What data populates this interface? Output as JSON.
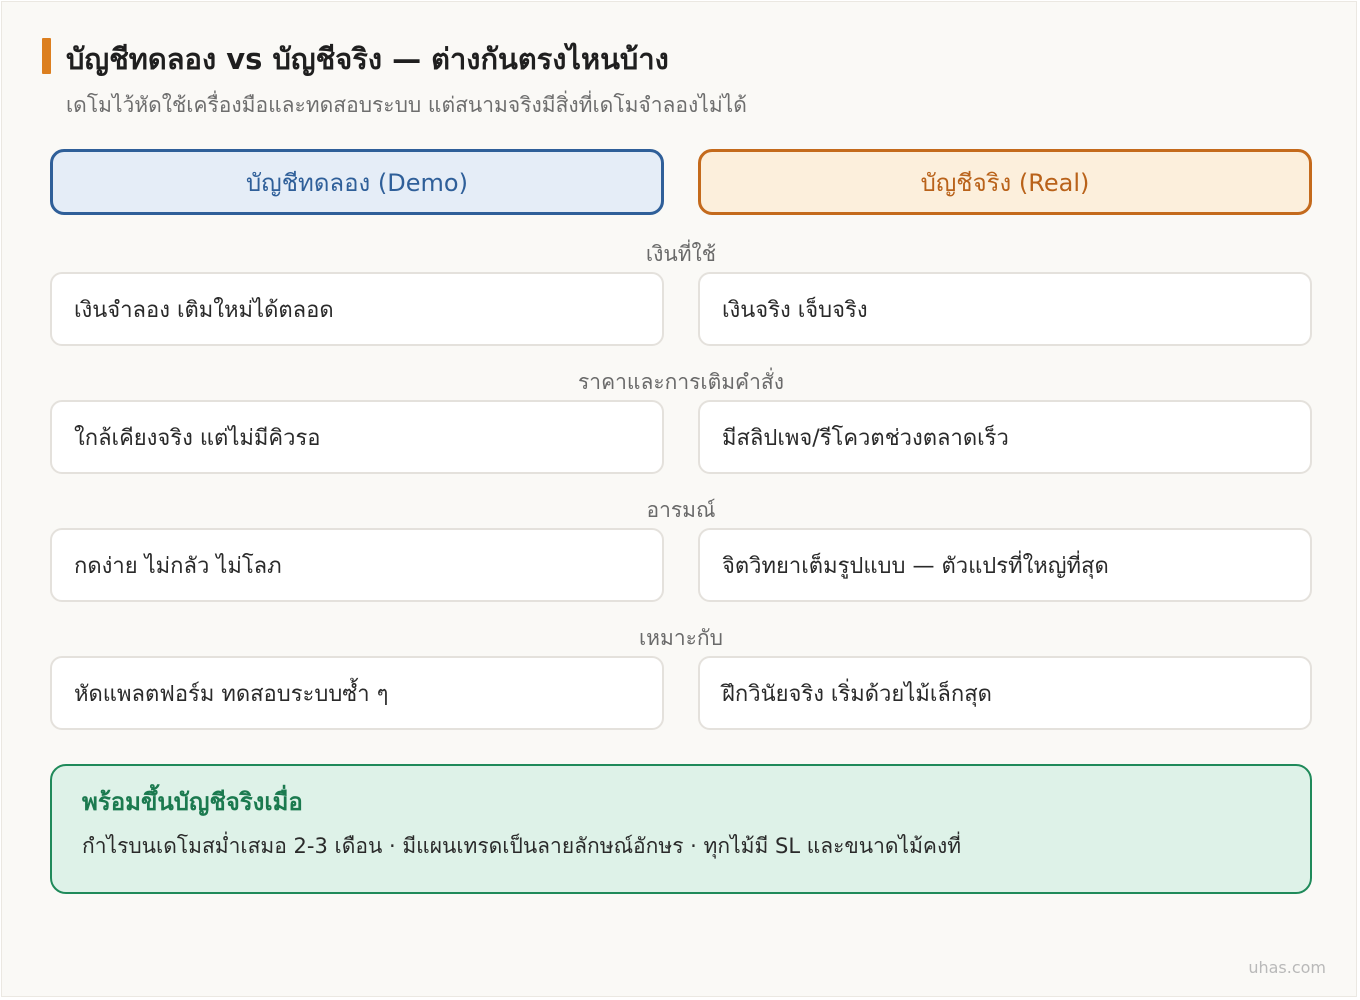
{
  "header": {
    "title": "บัญชีทดลอง vs บัญชีจริง — ต่างกันตรงไหนบ้าง",
    "subtitle": "เดโมไว้หัดใช้เครื่องมือและทดสอบระบบ แต่สนามจริงมีสิ่งที่เดโมจำลองไม่ได้"
  },
  "columns": {
    "demo": "บัญชีทดลอง (Demo)",
    "real": "บัญชีจริง (Real)"
  },
  "rows": [
    {
      "label": "เงินที่ใช้",
      "demo": "เงินจำลอง เติมใหม่ได้ตลอด",
      "real": "เงินจริง เจ็บจริง"
    },
    {
      "label": "ราคาและการเติมคำสั่ง",
      "demo": "ใกล้เคียงจริง แต่ไม่มีคิวรอ",
      "real": "มีสลิปเพจ/รีโควตช่วงตลาดเร็ว"
    },
    {
      "label": "อารมณ์",
      "demo": "กดง่าย ไม่กลัว ไม่โลภ",
      "real": "จิตวิทยาเต็มรูปแบบ — ตัวแปรที่ใหญ่ที่สุด"
    },
    {
      "label": "เหมาะกับ",
      "demo": "หัดแพลตฟอร์ม ทดสอบระบบซ้ำ ๆ",
      "real": "ฝึกวินัยจริง เริ่มด้วยไม้เล็กสุด"
    }
  ],
  "ready": {
    "title": "พร้อมขึ้นบัญชีจริงเมื่อ",
    "body": "กำไรบนเดโมสม่ำเสมอ 2-3 เดือน · มีแผนเทรดเป็นลายลักษณ์อักษร · ทุกไม้มี SL และขนาดไม้คงที่"
  },
  "watermark": "uhas.com",
  "colors": {
    "accent": "#dc7f1f",
    "demo_border": "#2f5f99",
    "demo_fill": "#e5edf7",
    "real_border": "#c46a1c",
    "real_fill": "#fcefdc",
    "ready_border": "#1f8a5a",
    "ready_fill": "#def2e8"
  }
}
